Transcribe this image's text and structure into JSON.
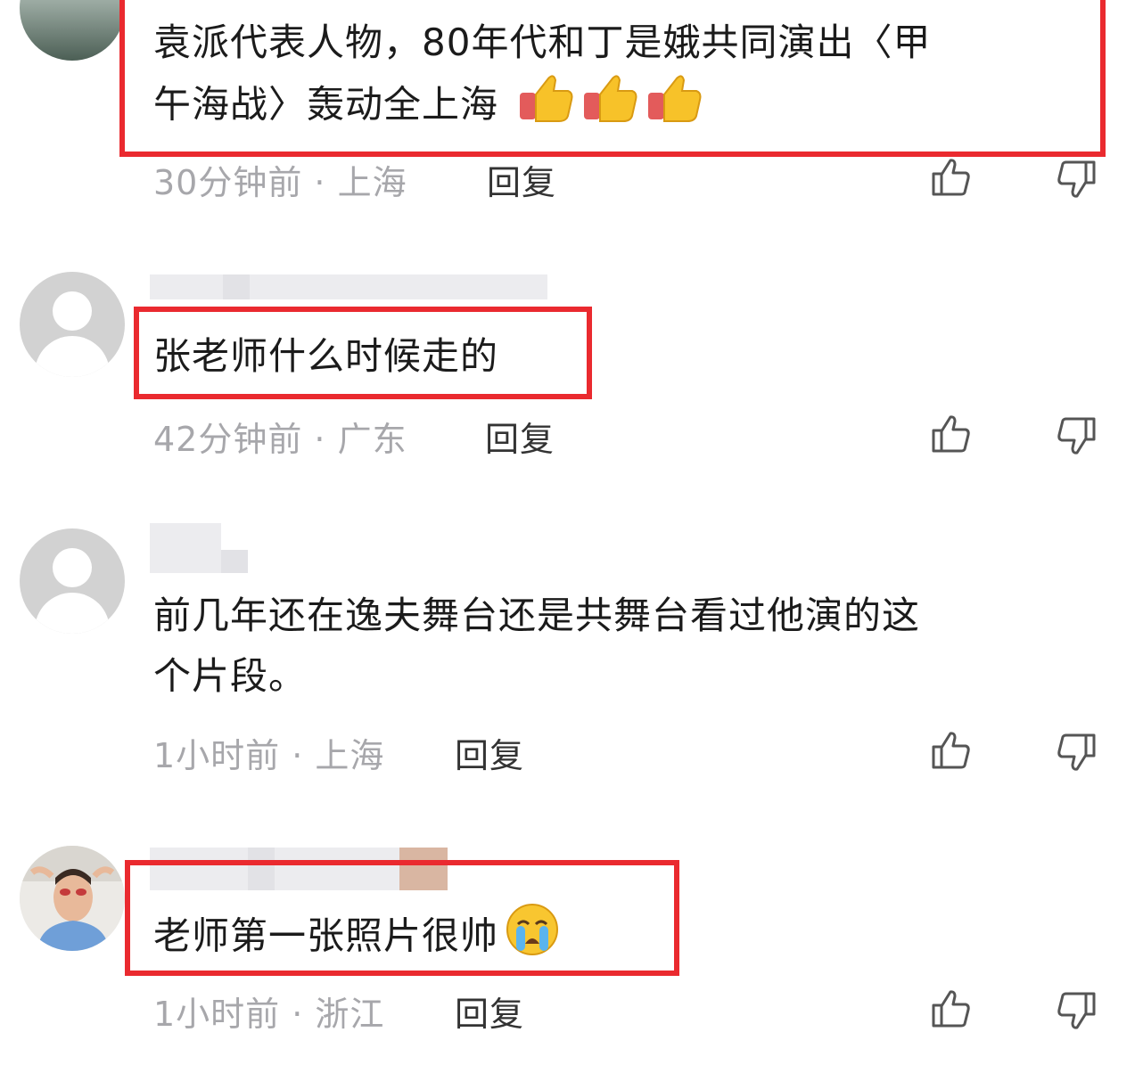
{
  "comments": [
    {
      "text": "袁派代表人物，80年代和丁是娥共同演出〈甲午海战〉轰动全上海",
      "text_line1": "袁派代表人物，80年代和丁是娥共同演出〈甲",
      "text_line2": "午海战〉轰动全上海",
      "meta": "30分钟前 · 上海",
      "reply_label": "回复",
      "emoji": [
        "thumbs-up",
        "thumbs-up",
        "thumbs-up"
      ]
    },
    {
      "text": "张老师什么时候走的",
      "meta": "42分钟前 · 广东",
      "reply_label": "回复"
    },
    {
      "text": "前几年还在逸夫舞台还是共舞台看过他演的这个片段。",
      "text_line1": "前几年还在逸夫舞台还是共舞台看过他演的这",
      "text_line2": "个片段。",
      "meta": "1小时前 · 上海",
      "reply_label": "回复"
    },
    {
      "text": "老师第一张照片很帅",
      "meta": "1小时前 · 浙江",
      "reply_label": "回复",
      "emoji": [
        "crying-face"
      ]
    }
  ],
  "icons": {
    "like": "thumbs-up-outline-icon",
    "dislike": "thumbs-down-outline-icon"
  },
  "colors": {
    "highlight_border": "#ea2a2f",
    "meta_text": "#a7a7ab",
    "icon_stroke": "#555555",
    "avatar_default": "#d2d2d2"
  }
}
